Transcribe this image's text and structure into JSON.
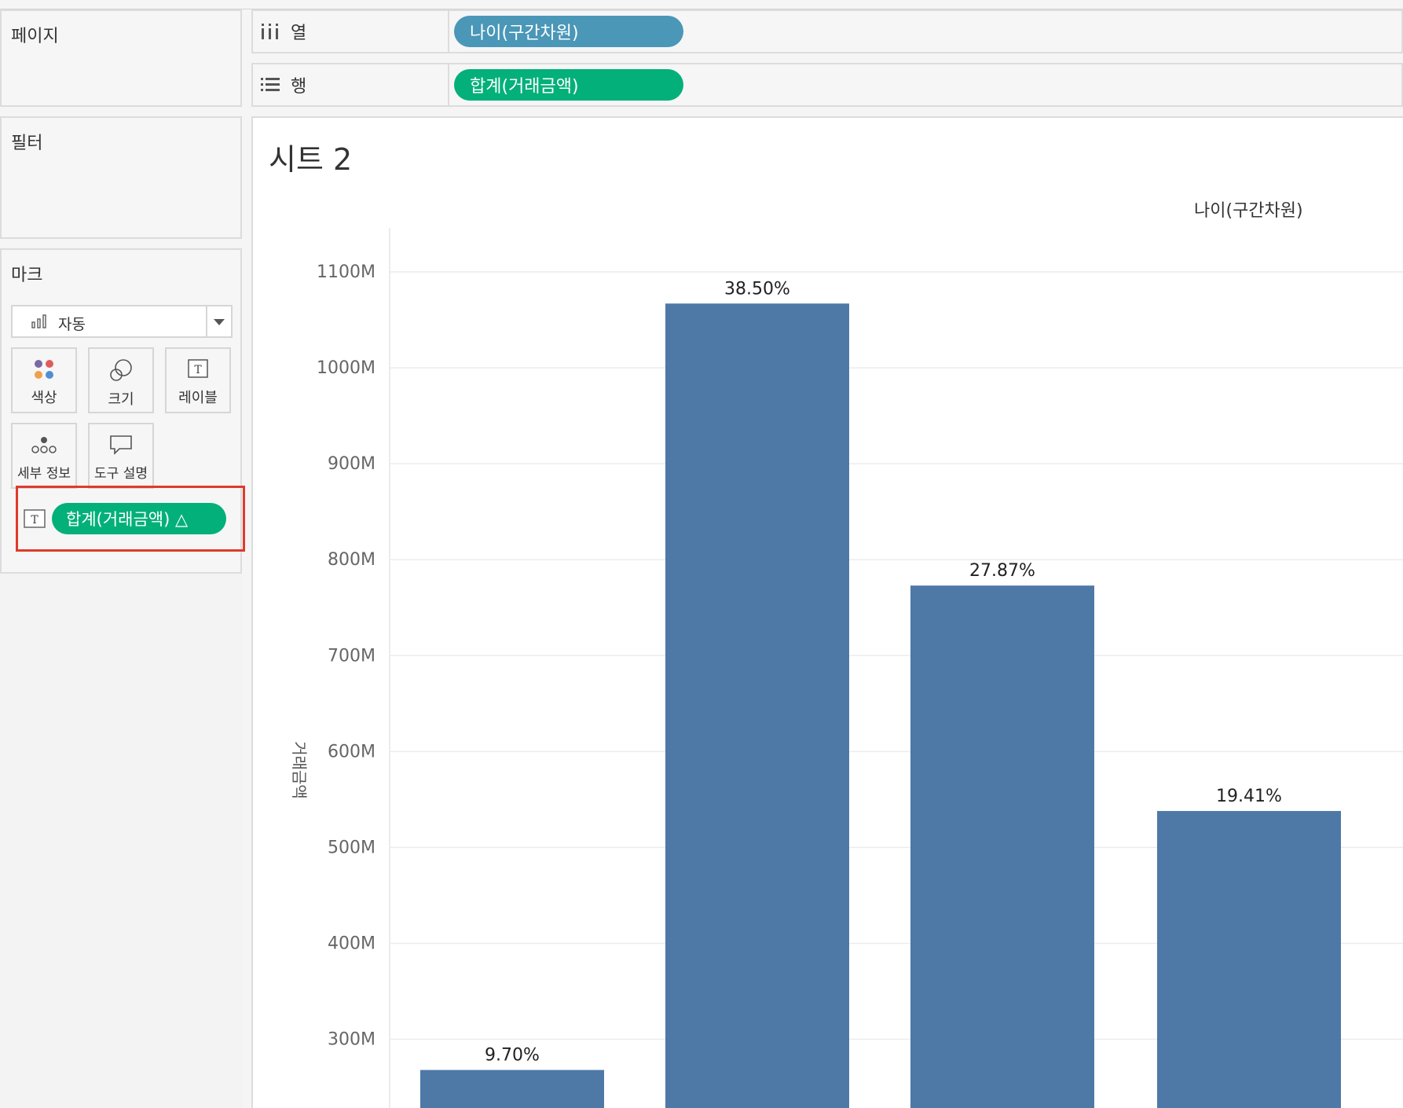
{
  "pages_panel": {
    "title": "페이지"
  },
  "filters_panel": {
    "title": "필터"
  },
  "marks_panel": {
    "title": "마크",
    "mark_type": "자동",
    "cards": [
      {
        "label": "색상",
        "icon": "color-dots-icon"
      },
      {
        "label": "크기",
        "icon": "size-icon"
      },
      {
        "label": "레이블",
        "icon": "label-icon"
      },
      {
        "label": "세부 정보",
        "icon": "detail-icon"
      },
      {
        "label": "도구 설명",
        "icon": "tooltip-icon"
      }
    ],
    "field_pill": {
      "label": "합계(거래금액) △",
      "icon": "text-icon"
    }
  },
  "shelves": {
    "columns": {
      "label": "열",
      "pill": "나이(구간차원)"
    },
    "rows": {
      "label": "행",
      "pill": "합계(거래금액)"
    }
  },
  "colors": {
    "bar": "#4e79a7",
    "pill_green": "#03b07a",
    "pill_blue": "#4a97b8",
    "highlight": "#e03a2a"
  },
  "sheet": {
    "title": "시트 2",
    "column_header": "나이(구간차원)"
  },
  "chart_data": {
    "type": "bar",
    "ylabel": "거래금액",
    "y_ticks": [
      "1100M",
      "1000M",
      "900M",
      "800M",
      "700M",
      "600M",
      "500M",
      "400M",
      "300M"
    ],
    "y_tick_values": [
      1100,
      1000,
      900,
      800,
      700,
      600,
      500,
      400,
      300
    ],
    "values": [
      268,
      1067,
      773,
      538
    ],
    "data_labels": [
      "9.70%",
      "38.50%",
      "27.87%",
      "19.41%"
    ],
    "grid": true
  }
}
